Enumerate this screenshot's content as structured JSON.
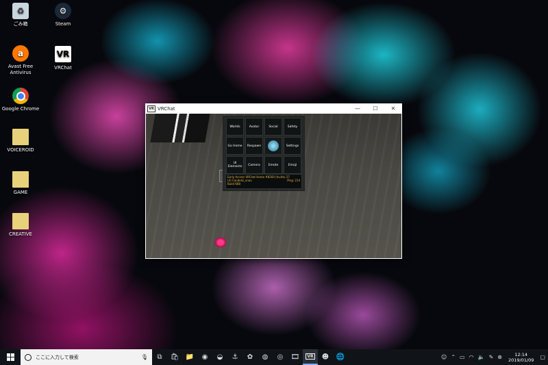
{
  "desktop": {
    "icons": [
      {
        "label": "ごみ箱",
        "name": "recycle-bin",
        "glyph": "♻",
        "color": "#c9d6e0"
      },
      {
        "label": "Steam",
        "name": "steam",
        "glyph": "⚙",
        "color": "#1b2838"
      },
      {
        "label": "Avast Free Antivirus",
        "name": "avast",
        "glyph": "a",
        "color": "#ff7800"
      },
      {
        "label": "VRChat",
        "name": "vrchat",
        "glyph": "VR",
        "color": "#ffffff"
      },
      {
        "label": "Google Chrome",
        "name": "chrome",
        "glyph": "◉",
        "color": "#4285f4"
      },
      {
        "label": "VOICEROID",
        "name": "voiceroid-folder",
        "glyph": "▮",
        "color": "#e8d17a"
      },
      {
        "label": "GAME",
        "name": "game-folder",
        "glyph": "▮",
        "color": "#e8d17a"
      },
      {
        "label": "CREATIVE",
        "name": "creative-folder",
        "glyph": "▮",
        "color": "#e8d17a"
      }
    ]
  },
  "window": {
    "title": "VRChat",
    "icon_text": "VR",
    "controls": {
      "minimize": "—",
      "maximize": "☐",
      "close": "✕"
    }
  },
  "vr_menu": {
    "buttons": [
      "Worlds",
      "Avatar",
      "Social",
      "Safety",
      "Go Home",
      "Respawn",
      "",
      "Settings",
      "UI Elements",
      "Camera",
      "Emote",
      "Emoji"
    ],
    "status_line1": "Early Access VRChat Home #8160 (Invite) 27",
    "status_line2": "(4) Candelis_vnov",
    "status_line3": "Build 668",
    "ping": "Ping: 214"
  },
  "taskbar": {
    "search_placeholder": "ここに入力して検索",
    "time": "12:14",
    "date": "2019/01/09"
  }
}
